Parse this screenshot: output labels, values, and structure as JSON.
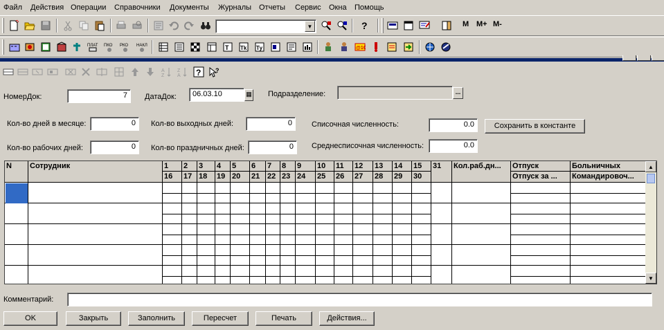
{
  "menu": [
    "Файл",
    "Действия",
    "Операции",
    "Справочники",
    "Документы",
    "Журналы",
    "Отчеты",
    "Сервис",
    "Окна",
    "Помощь"
  ],
  "toolbar": {
    "combo_value": "",
    "m_label": "M",
    "mplus_label": "M+",
    "mminus_label": "M-"
  },
  "form": {
    "doc_number_label": "НомерДок:",
    "doc_number": "7",
    "doc_date_label": "ДатаДок:",
    "doc_date": "06.03.10",
    "department_label": "Подразделение:",
    "department": "",
    "days_in_month_label": "Кол-во дней в месяце:",
    "days_in_month": "0",
    "days_off_label": "Кол-во выходных дней:",
    "days_off": "0",
    "headcount_label": "Списочная численность:",
    "headcount": "0.0",
    "save_const_label": "Сохранить в константе",
    "work_days_label": "Кол-во рабочих дней:",
    "work_days": "0",
    "holidays_label": "Кол-во праздничных дней:",
    "holidays": "0",
    "avg_headcount_label": "Среднесписочная численность:",
    "avg_headcount": "0.0"
  },
  "grid": {
    "col_n": "N",
    "col_employee": "Сотрудник",
    "days_top": [
      "1",
      "2",
      "3",
      "4",
      "5",
      "6",
      "7",
      "8",
      "9",
      "10",
      "11",
      "12",
      "13",
      "14",
      "15",
      "31"
    ],
    "days_bottom": [
      "16",
      "17",
      "18",
      "19",
      "20",
      "21",
      "22",
      "23",
      "24",
      "25",
      "26",
      "27",
      "28",
      "29",
      "30"
    ],
    "col_workdays": "Кол.раб.дн...",
    "col_vacation": "Отпуск",
    "col_vacation_for": "Отпуск за ...",
    "col_sick": "Больничных",
    "col_business_trip": "Командировоч..."
  },
  "comment_label": "Комментарий:",
  "comment": "",
  "buttons": {
    "ok": "OK",
    "close": "Закрыть",
    "fill": "Заполнить",
    "recalc": "Пересчет",
    "print": "Печать",
    "actions": "Действия..."
  }
}
